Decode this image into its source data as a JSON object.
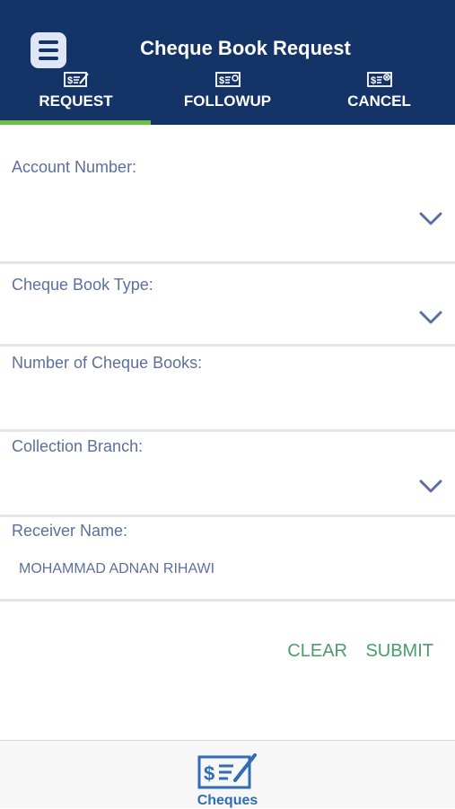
{
  "header": {
    "title": "Cheque Book Request",
    "background_color": "#143366",
    "menu_icon": "hamburger-menu-icon"
  },
  "tabs": [
    {
      "label": "REQUEST",
      "icon": "cheque-request-icon",
      "active": true
    },
    {
      "label": "FOLLOWUP",
      "icon": "cheque-followup-icon",
      "active": false
    },
    {
      "label": "CANCEL",
      "icon": "cheque-cancel-icon",
      "active": false
    }
  ],
  "active_tab_color": "#6cc04a",
  "form": {
    "account_number": {
      "label": "Account Number:",
      "value": ""
    },
    "cheque_book_type": {
      "label": "Cheque Book Type:",
      "value": ""
    },
    "number_of_cheque_books": {
      "label": "Number of Cheque Books:",
      "value": ""
    },
    "collection_branch": {
      "label": "Collection Branch:",
      "value": ""
    },
    "receiver_name": {
      "label": "Receiver Name:",
      "value": "MOHAMMAD ADNAN RIHAWI"
    }
  },
  "actions": {
    "clear_label": "CLEAR",
    "submit_label": "SUBMIT",
    "color": "#4a9d6a"
  },
  "bottom_nav": {
    "label": "Cheques",
    "icon": "cheque-icon"
  }
}
